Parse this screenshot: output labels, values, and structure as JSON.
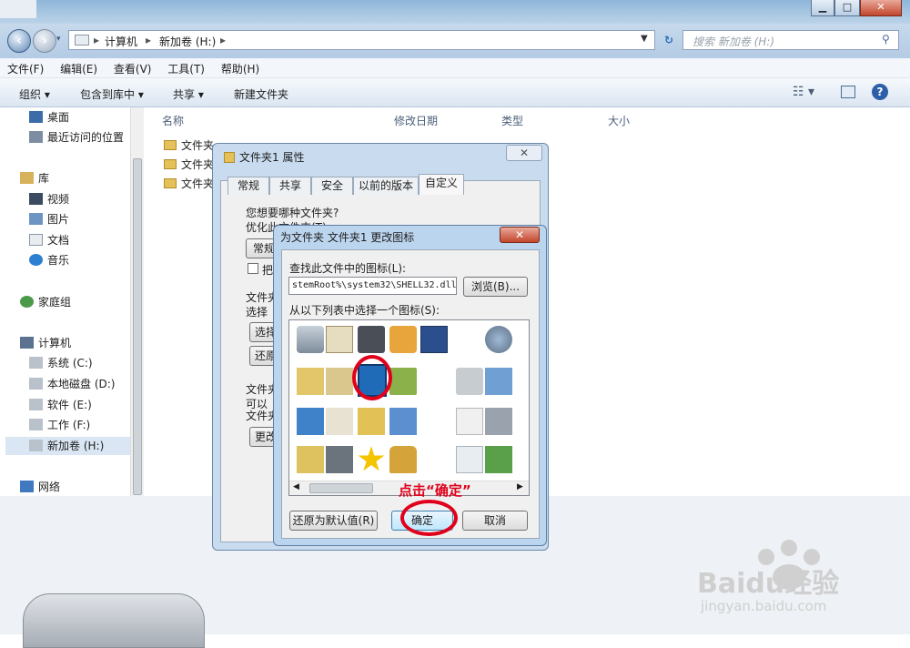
{
  "explorer": {
    "address": {
      "segments": [
        "计算机",
        "新加卷 (H:)"
      ]
    },
    "search_placeholder": "搜索 新加卷 (H:)",
    "menu": [
      "文件(F)",
      "编辑(E)",
      "查看(V)",
      "工具(T)",
      "帮助(H)"
    ],
    "toolbar": {
      "organize": "组织 ▾",
      "include_library": "包含到库中 ▾",
      "share": "共享 ▾",
      "new_folder": "新建文件夹"
    },
    "nav": {
      "favorites": [
        "桌面",
        "最近访问的位置"
      ],
      "library": "库",
      "library_items": [
        "视频",
        "图片",
        "文档",
        "音乐"
      ],
      "homegroup": "家庭组",
      "computer": "计算机",
      "drives": [
        "系统 (C:)",
        "本地磁盘 (D:)",
        "软件 (E:)",
        "工作 (F:)",
        "新加卷 (H:)"
      ],
      "network": "网络"
    },
    "columns": [
      "名称",
      "修改日期",
      "类型",
      "大小"
    ],
    "files": [
      "文件夹",
      "文件夹",
      "文件夹"
    ]
  },
  "properties_dialog": {
    "title": "文件夹1 属性",
    "tabs": [
      "常规",
      "共享",
      "安全",
      "以前的版本",
      "自定义"
    ],
    "q1": "您想要哪种文件夹?",
    "q1_sub": "优化此文件夹(T):",
    "template_btn": "常规",
    "checkbox_label": "把",
    "section2_title": "文件夹",
    "section2_sub": "选择",
    "choose_btn": "选择",
    "restore_btn": "还原",
    "section3_title": "文件夹",
    "section3_sub1": "可以",
    "section3_sub2": "文件夹",
    "change_btn": "更改"
  },
  "icon_dialog": {
    "title": "为文件夹 文件夹1 更改图标",
    "find_label": "查找此文件中的图标(L):",
    "file_path": "stemRoot%\\system32\\SHELL32.dll",
    "browse_btn": "浏览(B)...",
    "choose_label": "从以下列表中选择一个图标(S):",
    "restore_default_btn": "还原为默认值(R)",
    "ok_btn": "确定",
    "cancel_btn": "取消"
  },
  "annotation": "点击“确定”",
  "watermark": {
    "brand": "Baidu经验",
    "url": "jingyan.baidu.com"
  }
}
